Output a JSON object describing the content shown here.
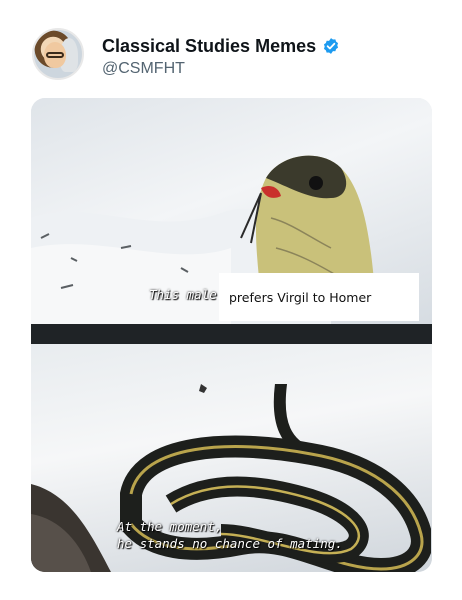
{
  "tweet": {
    "display_name": "Classical Studies Memes",
    "handle": "@CSMFHT",
    "verified": true,
    "avatar_icon": "avatar"
  },
  "meme": {
    "top_subtitle": "This male",
    "top_caption": "prefers Virgil to Homer",
    "bottom_subtitle_line1": "At the moment,",
    "bottom_subtitle_line2": "he stands no chance of mating."
  },
  "colors": {
    "verified_blue": "#1d9bf0",
    "name_text": "#0f1419",
    "handle_text": "#536471"
  }
}
